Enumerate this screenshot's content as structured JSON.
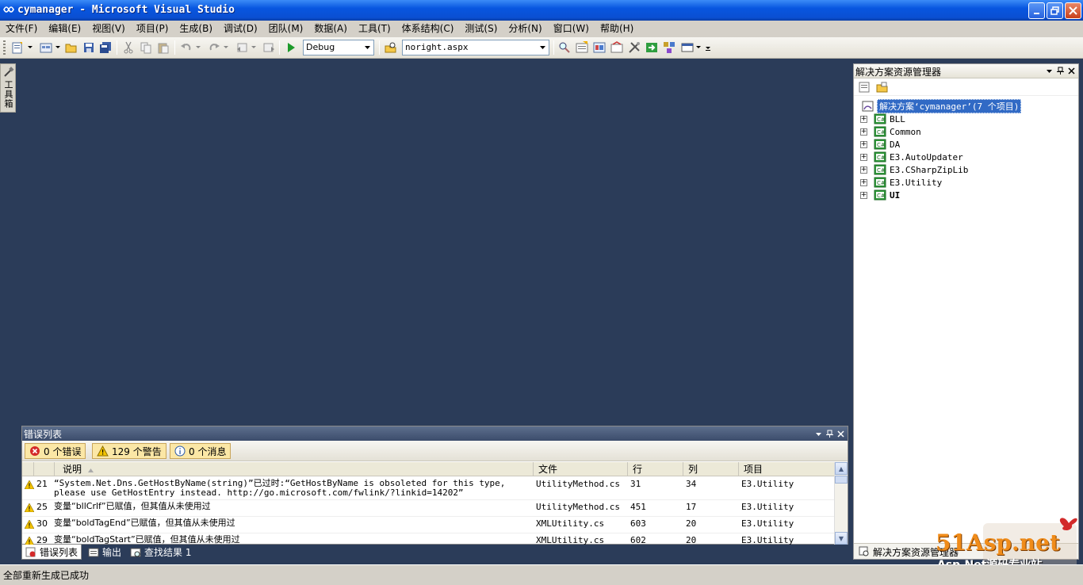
{
  "window": {
    "title": "cymanager - Microsoft Visual Studio"
  },
  "menu": [
    "文件(F)",
    "编辑(E)",
    "视图(V)",
    "项目(P)",
    "生成(B)",
    "调试(D)",
    "团队(M)",
    "数据(A)",
    "工具(T)",
    "体系结构(C)",
    "测试(S)",
    "分析(N)",
    "窗口(W)",
    "帮助(H)"
  ],
  "toolbar": {
    "config": "Debug",
    "startpage": "noright.aspx"
  },
  "left_strip": {
    "label": "工具箱"
  },
  "solution_explorer": {
    "title": "解决方案资源管理器",
    "root": "解决方案‘cymanager’(7 个项目)",
    "projects": [
      "BLL",
      "Common",
      "DA",
      "E3.AutoUpdater",
      "E3.CSharpZipLib",
      "E3.Utility",
      "UI"
    ],
    "footer_tab": "解决方案资源管理器"
  },
  "error_list": {
    "title": "错误列表",
    "filters": {
      "errors": "0 个错误",
      "warnings": "129 个警告",
      "messages": "0 个消息"
    },
    "columns": {
      "desc": "说明",
      "file": "文件",
      "line": "行",
      "col": "列",
      "project": "项目"
    },
    "rows": [
      {
        "num": "21",
        "desc": "“System.Net.Dns.GetHostByName(string)”已过时:“GetHostByName is obsoleted for this type, please use GetHostEntry instead. http://go.microsoft.com/fwlink/?linkid=14202”",
        "file": "UtilityMethod.cs",
        "line": "31",
        "col": "34",
        "project": "E3.Utility"
      },
      {
        "num": "25",
        "desc": "变量“bllCrlf”已赋值，但其值从未使用过",
        "file": "UtilityMethod.cs",
        "line": "451",
        "col": "17",
        "project": "E3.Utility"
      },
      {
        "num": "30",
        "desc": "变量“boldTagEnd”已赋值，但其值从未使用过",
        "file": "XMLUtility.cs",
        "line": "603",
        "col": "20",
        "project": "E3.Utility"
      },
      {
        "num": "29",
        "desc": "变量“boldTagStart”已赋值，但其值从未使用过",
        "file": "XMLUtility.cs",
        "line": "602",
        "col": "20",
        "project": "E3.Utility"
      }
    ]
  },
  "bottom_tabs": [
    "错误列表",
    "输出",
    "查找结果 1"
  ],
  "status": "全部重新生成已成功",
  "watermark": {
    "big": "51Asp.net",
    "small": "Asp.Net源码专业站"
  },
  "colors": {
    "background": "#2b3c59",
    "title_blue": "#0a4fd2",
    "selection": "#316ac5"
  }
}
